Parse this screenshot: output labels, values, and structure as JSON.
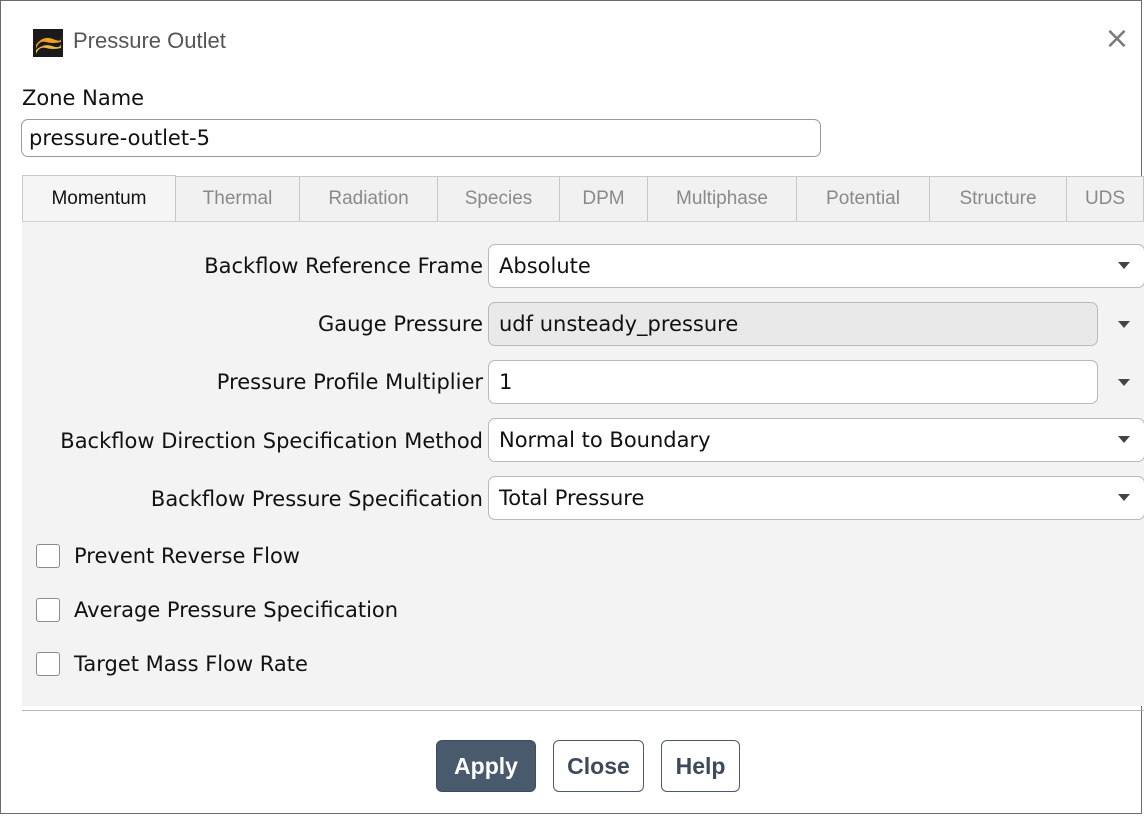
{
  "window": {
    "title": "Pressure Outlet",
    "close_glyph": "×"
  },
  "zone": {
    "label": "Zone Name",
    "value": "pressure-outlet-5"
  },
  "tabs": [
    {
      "label": "Momentum",
      "active": true
    },
    {
      "label": "Thermal",
      "active": false
    },
    {
      "label": "Radiation",
      "active": false
    },
    {
      "label": "Species",
      "active": false
    },
    {
      "label": "DPM",
      "active": false
    },
    {
      "label": "Multiphase",
      "active": false
    },
    {
      "label": "Potential",
      "active": false
    },
    {
      "label": "Structure",
      "active": false
    },
    {
      "label": "UDS",
      "active": false
    }
  ],
  "momentum": {
    "backflow_reference_frame": {
      "label": "Backflow Reference Frame",
      "value": "Absolute"
    },
    "gauge_pressure": {
      "label": "Gauge Pressure",
      "value": "udf unsteady_pressure"
    },
    "pressure_profile_multiplier": {
      "label": "Pressure Profile Multiplier",
      "value": "1"
    },
    "backflow_direction_method": {
      "label": "Backflow Direction Specification Method",
      "value": "Normal to Boundary"
    },
    "backflow_pressure_spec": {
      "label": "Backflow Pressure Specification",
      "value": "Total Pressure"
    },
    "checkboxes": [
      {
        "label": "Prevent Reverse Flow",
        "checked": false
      },
      {
        "label": "Average Pressure Specification",
        "checked": false
      },
      {
        "label": "Target Mass Flow Rate",
        "checked": false
      }
    ]
  },
  "buttons": {
    "apply": "Apply",
    "close": "Close",
    "help": "Help"
  },
  "colors": {
    "apply_bg": "#4a5a6d",
    "panel_bg": "#f3f3f3"
  }
}
